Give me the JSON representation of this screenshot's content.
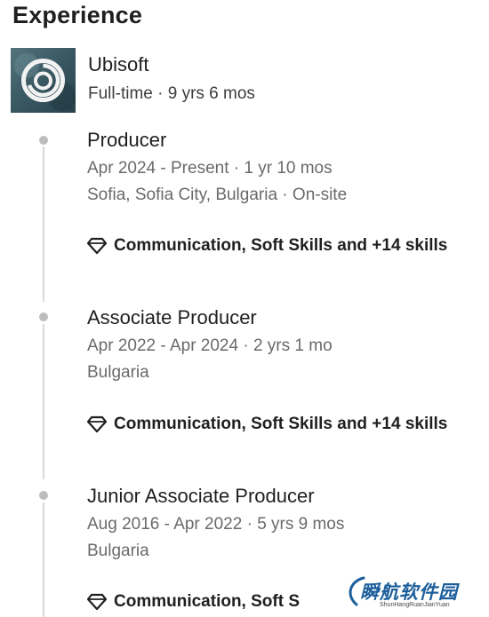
{
  "section": {
    "title": "Experience"
  },
  "company": {
    "name": "Ubisoft",
    "meta": "Full-time · 9 yrs 6 mos"
  },
  "roles": [
    {
      "title": "Producer",
      "dates": "Apr 2024 - Present · 1 yr 10 mos",
      "location": "Sofia, Sofia City, Bulgaria · On-site",
      "skills": "Communication, Soft Skills and +14 skills"
    },
    {
      "title": "Associate Producer",
      "dates": "Apr 2022 - Apr 2024 · 2 yrs 1 mo",
      "location": "Bulgaria",
      "skills": "Communication, Soft Skills and +14 skills"
    },
    {
      "title": "Junior Associate Producer",
      "dates": "Aug 2016 - Apr 2022 · 5 yrs 9 mos",
      "location": "Bulgaria",
      "skills": "Communication, Soft S"
    }
  ],
  "watermark": {
    "text": "瞬航软件园",
    "subtext": "ShunHangRuanJianYuan"
  },
  "icons": {
    "logo": "ubisoft-swirl-logo",
    "skills": "diamond-gem-icon",
    "timeline": "timeline-dot"
  },
  "colors": {
    "timeline_line": "#d9d9d9",
    "timeline_dot": "#bdbdbd",
    "watermark": "#1d5f9b"
  }
}
